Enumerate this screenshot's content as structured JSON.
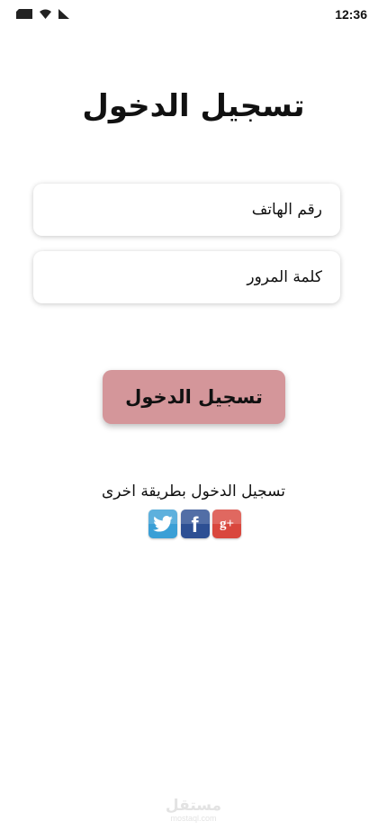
{
  "status_bar": {
    "time": "12:36",
    "icons": [
      "sim-card-icon",
      "wifi-icon",
      "signal-icon"
    ]
  },
  "title": "تسجيل الدخول",
  "form": {
    "phone_placeholder": "رقم الهاتف",
    "password_placeholder": "كلمة المرور"
  },
  "login_button_label": "تسجيل الدخول",
  "alt_login": {
    "text": "تسجيل الدخول بطريقة اخرى",
    "social": [
      {
        "name": "twitter-icon",
        "color": "#3a9fd6"
      },
      {
        "name": "facebook-icon",
        "color": "#2d4f93",
        "glyph": "f"
      },
      {
        "name": "google-plus-icon",
        "color": "#d9473d",
        "glyph": "g+"
      }
    ]
  },
  "watermark": {
    "logo_text": "مستقل",
    "subtext": "mostaql.com"
  },
  "colors": {
    "primary_button": "#d4969a",
    "background": "#ffffff",
    "text": "#111111"
  }
}
